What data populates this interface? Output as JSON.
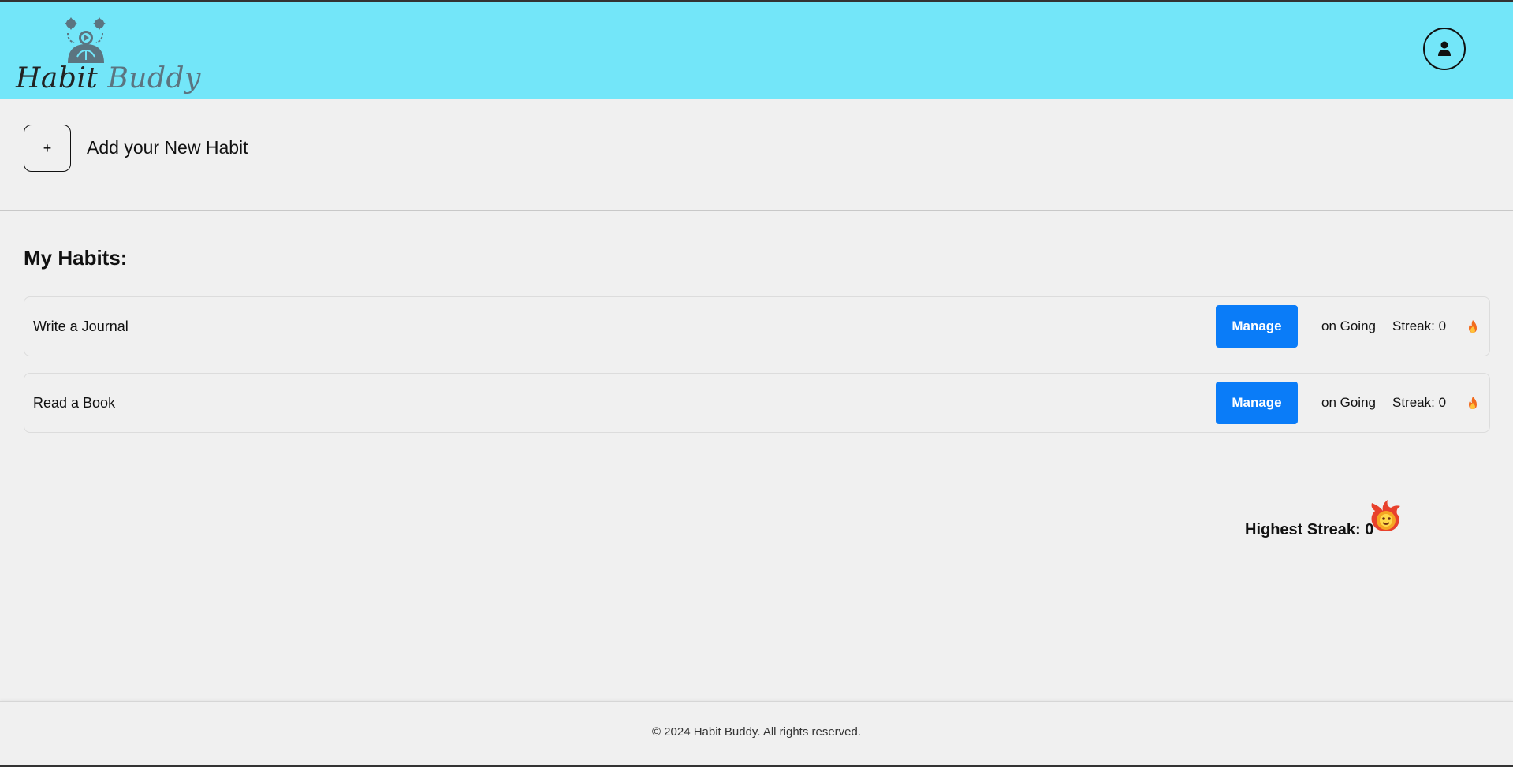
{
  "header": {
    "logo_word1": "Habit",
    "logo_word2": "Buddy",
    "profile_icon": "user-icon"
  },
  "add_habit": {
    "button_symbol": "+",
    "label": "Add your New Habit"
  },
  "habits_section": {
    "title": "My Habits:",
    "items": [
      {
        "name": "Write a Journal",
        "action": "Manage",
        "status": "on Going",
        "streak": "Streak: 0",
        "icon": "flame-icon"
      },
      {
        "name": "Read a Book",
        "action": "Manage",
        "status": "on Going",
        "streak": "Streak: 0",
        "icon": "flame-icon"
      }
    ]
  },
  "highest_streak": {
    "label": "Highest Streak: 0",
    "icon": "fireball-icon"
  },
  "footer": {
    "copyright": "© 2024 Habit Buddy. All rights reserved."
  },
  "colors": {
    "header_bg": "#73e6f9",
    "manage_button": "#0a7cf8",
    "page_bg": "#f0f0f0"
  }
}
